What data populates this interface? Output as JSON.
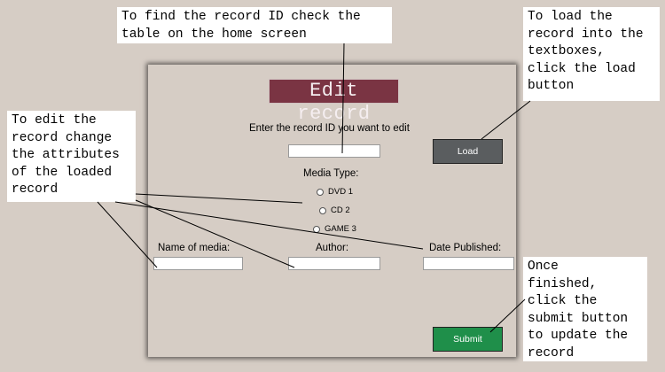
{
  "callouts": {
    "home_screen": "To find the record ID check the\ntable on the home screen",
    "load": "To load the\nrecord into the\ntextboxes,\nclick the load\nbutton",
    "edit": "To edit the\nrecord change\nthe attributes\nof the loaded\nrecord",
    "submit": "Once\nfinished,\nclick the\nsubmit button\nto update the\nrecord"
  },
  "window": {
    "title": "Edit record",
    "record_id_prompt": "Enter the record ID you want to edit",
    "load_label": "Load",
    "media_type_label": "Media Type:",
    "media_options": [
      "DVD 1",
      "CD 2",
      "GAME 3"
    ],
    "name_label": "Name of media:",
    "author_label": "Author:",
    "date_label": "Date Published:",
    "submit_label": "Submit",
    "fields": {
      "record_id": "",
      "name": "",
      "author": "",
      "date": ""
    }
  }
}
